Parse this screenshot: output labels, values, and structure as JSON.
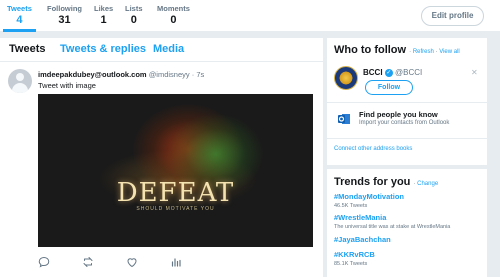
{
  "stats": [
    {
      "label": "Tweets",
      "value": "4"
    },
    {
      "label": "Following",
      "value": "31"
    },
    {
      "label": "Likes",
      "value": "1"
    },
    {
      "label": "Lists",
      "value": "0"
    },
    {
      "label": "Moments",
      "value": "0"
    }
  ],
  "edit_profile_label": "Edit profile",
  "tabs": [
    "Tweets",
    "Tweets & replies",
    "Media"
  ],
  "tweet": {
    "name": "imdeepakdubey@outlook.com",
    "handle": "@imdisneyy",
    "separator": "·",
    "time": "7s",
    "text": "Tweet with image",
    "image_title": "DEFEAT",
    "image_subtitle": "SHOULD MOTIVATE YOU"
  },
  "who_to_follow": {
    "title": "Who to follow",
    "refresh": "Refresh",
    "dot": "·",
    "view_all": "View all",
    "account_name": "BCCI",
    "account_handle": "@BCCI",
    "follow_label": "Follow",
    "find_title": "Find people you know",
    "find_sub": "Import your contacts from Outlook",
    "connect": "Connect other address books"
  },
  "trends": {
    "title": "Trends for you",
    "dot": "·",
    "change": "Change",
    "items": [
      {
        "name": "#MondayMotivation",
        "sub": "46.5K Tweets"
      },
      {
        "name": "#WrestleMania",
        "sub": "The universal title was at stake at WrestleMania"
      },
      {
        "name": "#JayaBachchan",
        "sub": ""
      },
      {
        "name": "#KKRvRCB",
        "sub": "85.1K Tweets"
      }
    ]
  },
  "colors": {
    "accent": "#1da1f2",
    "text": "#14171a",
    "muted": "#657786",
    "background": "#e6ecf0"
  }
}
